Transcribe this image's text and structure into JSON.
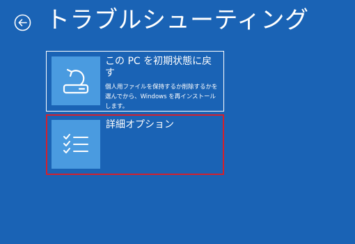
{
  "page": {
    "title": "トラブルシューティング"
  },
  "options": [
    {
      "title": "この PC を初期状態に戻す",
      "description": "個人用ファイルを保持するか削除するかを選んでから、Windows を再インストールします。",
      "icon": "reset-pc-icon"
    },
    {
      "title": "詳細オプション",
      "description": "",
      "icon": "checklist-icon"
    }
  ],
  "colors": {
    "background": "#1a63b5",
    "tile": "#4a9be0",
    "highlight": "#d4202d",
    "text": "#ffffff"
  }
}
